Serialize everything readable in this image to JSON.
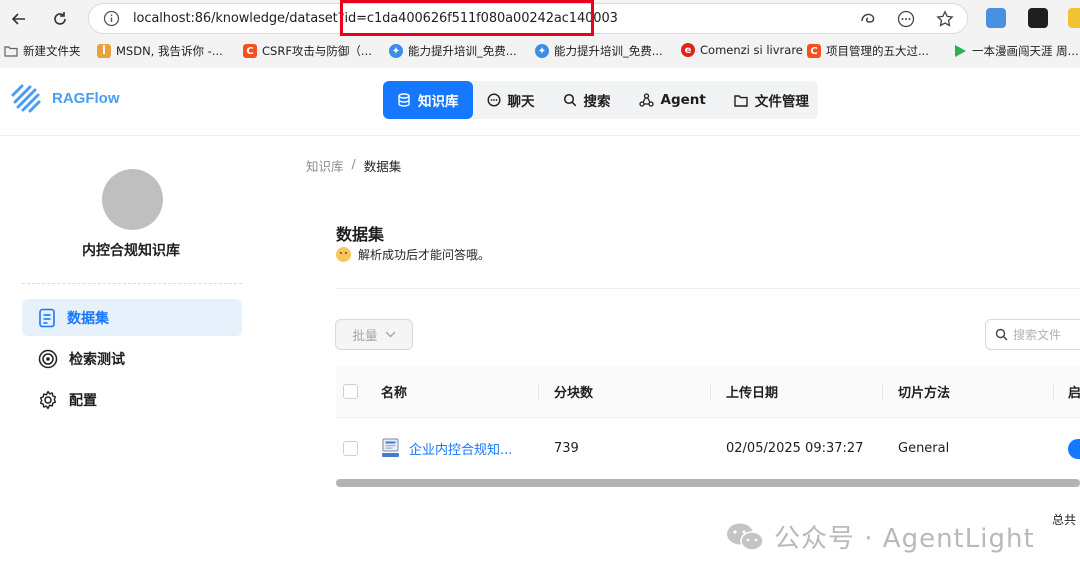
{
  "browser": {
    "url_base": "localhost:86/knowledge/dataset?id=",
    "url_id": "c1da400626f511f080a00242ac140003",
    "bookmarks": [
      {
        "label": "新建文件夹",
        "icon": "folder-icon",
        "color": "#5f6368"
      },
      {
        "label": "MSDN, 我告诉你 -...",
        "icon": "msdn-icon",
        "color": "#e8a23b"
      },
      {
        "label": "CSRF攻击与防御（...",
        "icon": "csdn-icon",
        "color": "#f4511e"
      },
      {
        "label": "能力提升培训_免费...",
        "icon": "training-icon",
        "color": "#3b8de8"
      },
      {
        "label": "能力提升培训_免费...",
        "icon": "training-icon",
        "color": "#3b8de8"
      },
      {
        "label": "Comenzi si livrare",
        "icon": "e-icon",
        "color": "#e2231a"
      },
      {
        "label": "项目管理的五大过...",
        "icon": "csdn-icon",
        "color": "#f4511e"
      },
      {
        "label": "一本漫画闯天涯 周...",
        "icon": "play-icon",
        "color": "#2bb24c"
      }
    ]
  },
  "app": {
    "logo_text": "RAGFlow",
    "nav": [
      {
        "label": "知识库",
        "icon": "database-icon",
        "active": true
      },
      {
        "label": "聊天",
        "icon": "chat-icon",
        "active": false
      },
      {
        "label": "搜索",
        "icon": "search-icon",
        "active": false
      },
      {
        "label": "Agent",
        "icon": "agent-icon",
        "active": false
      },
      {
        "label": "文件管理",
        "icon": "folder-icon",
        "active": false
      }
    ]
  },
  "sidebar": {
    "kb_name": "内控合规知识库",
    "items": [
      {
        "label": "数据集",
        "icon": "document-icon",
        "active": true
      },
      {
        "label": "检索测试",
        "icon": "target-icon",
        "active": false
      },
      {
        "label": "配置",
        "icon": "gear-icon",
        "active": false
      }
    ]
  },
  "main": {
    "breadcrumb": [
      "知识库",
      "数据集"
    ],
    "title": "数据集",
    "subtitle": "解析成功后才能问答哦。",
    "batch_label": "批量",
    "search_placeholder": "搜索文件",
    "columns": [
      "名称",
      "分块数",
      "上传日期",
      "切片方法",
      "启"
    ],
    "rows": [
      {
        "name": "企业内控合规知...",
        "chunks": "739",
        "upload_date": "02/05/2025 09:37:27",
        "chunk_method": "General",
        "enabled": true
      }
    ],
    "total_label": "总共"
  },
  "watermark": {
    "text": "公众号 · AgentLight"
  }
}
